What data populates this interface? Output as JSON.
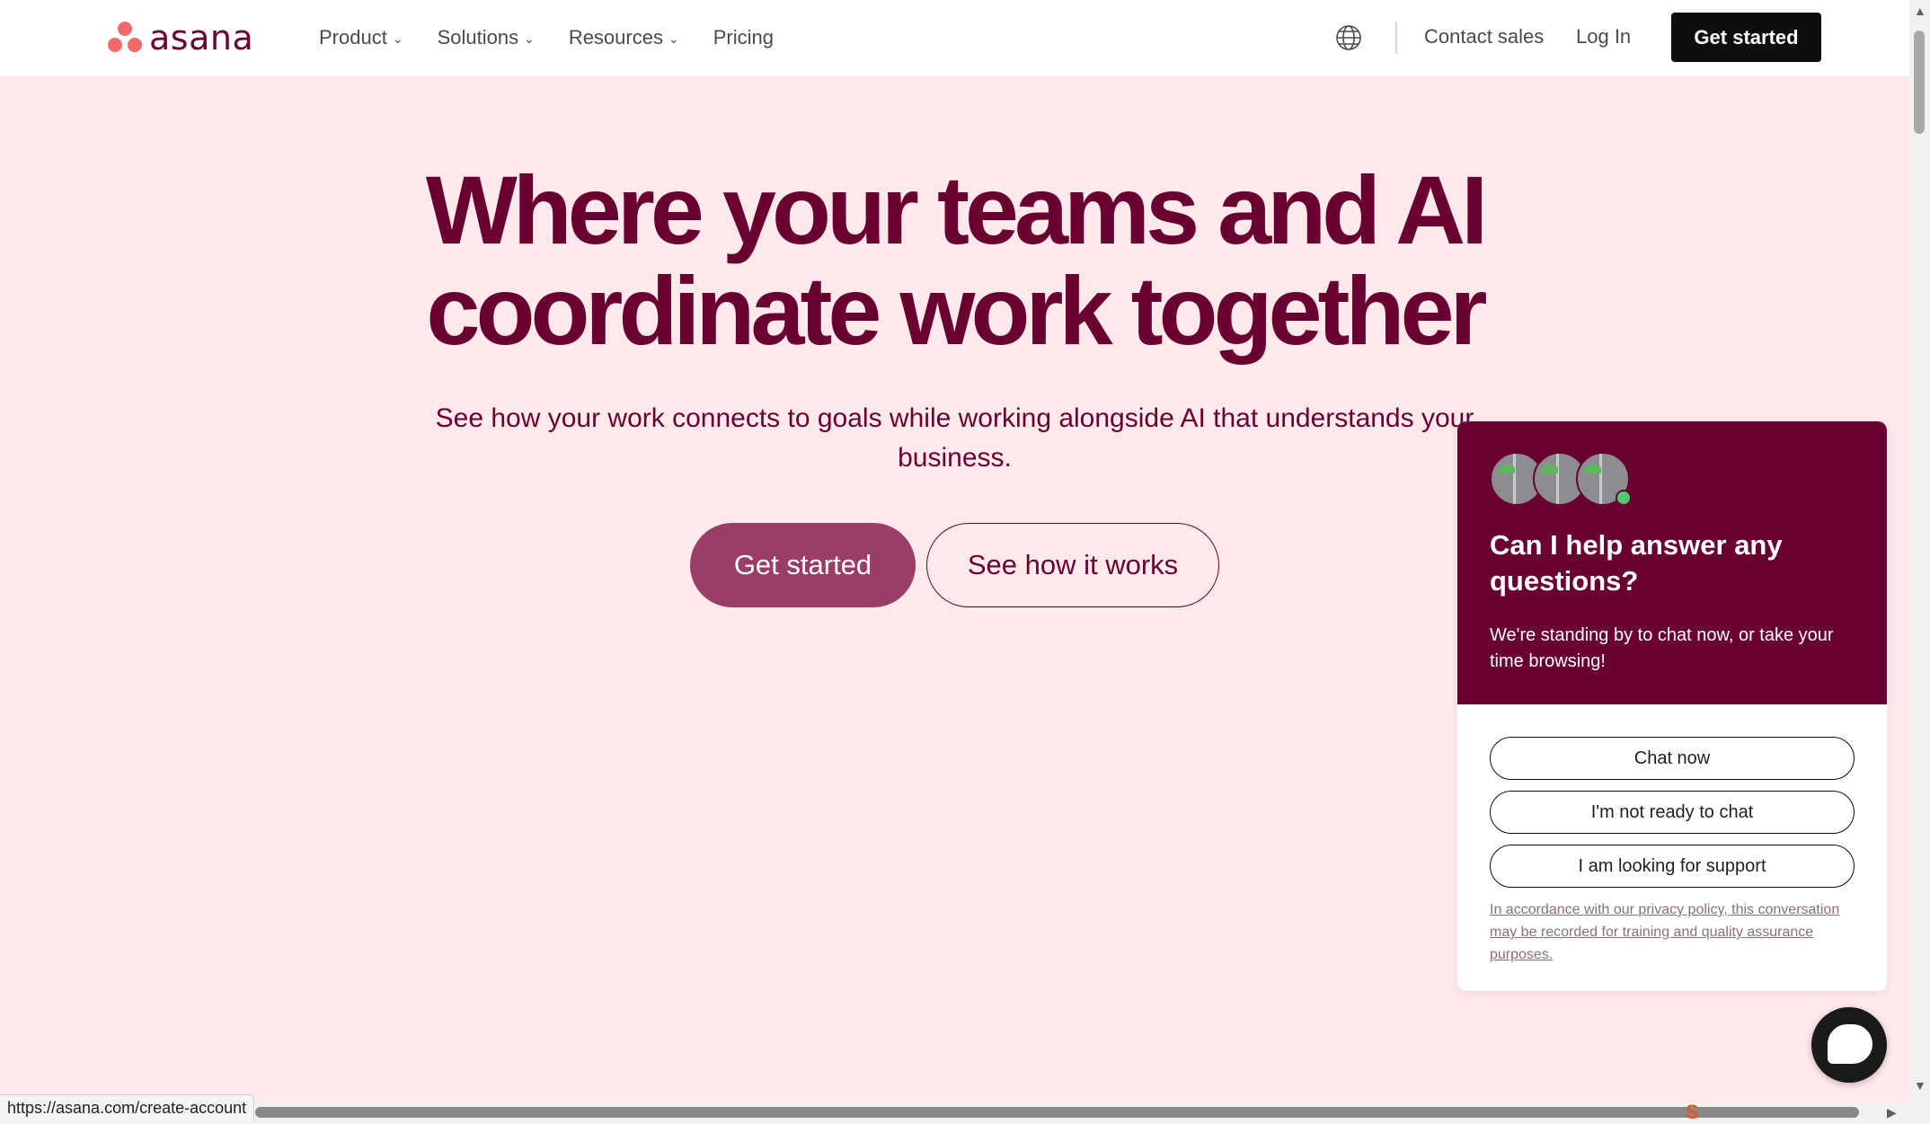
{
  "header": {
    "logo_text": "asana",
    "nav": [
      {
        "label": "Product",
        "has_menu": true
      },
      {
        "label": "Solutions",
        "has_menu": true
      },
      {
        "label": "Resources",
        "has_menu": true
      },
      {
        "label": "Pricing",
        "has_menu": false
      }
    ],
    "language_icon": "globe-icon",
    "contact_label": "Contact sales",
    "login_label": "Log In",
    "cta_label": "Get started"
  },
  "hero": {
    "title_line1": "Where your teams and AI",
    "title_line2": "coordinate work together",
    "subtitle": "See how your work connects to goals while working alongside AI that understands your business.",
    "primary_cta": "Get started",
    "secondary_cta": "See how it works"
  },
  "chat": {
    "title": "Can I help answer any questions?",
    "text": "We're standing by to chat now, or take your time browsing!",
    "options": [
      "Chat now",
      "I'm not ready to chat",
      "I am looking for support"
    ],
    "legal": "In accordance with our privacy policy, this conversation may be recorded for training and quality assurance purposes.",
    "launcher_icon": "chat-bubble-icon"
  },
  "browser": {
    "status_url": "https://asana.com/create-account"
  },
  "colors": {
    "brand": "#690031",
    "background": "#ffe9ea",
    "primary_button": "#9b3e67",
    "logo": "#f06a6a"
  }
}
